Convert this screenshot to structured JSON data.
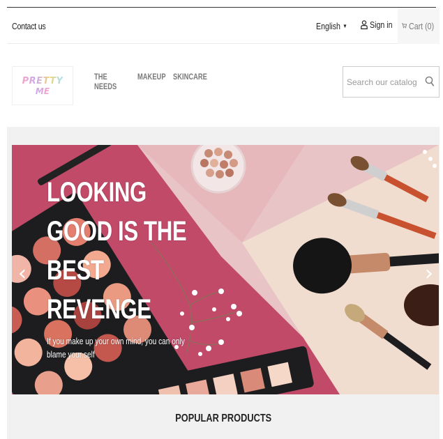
{
  "topbar": {
    "contact": "Contact us",
    "language": "English",
    "signin": "Sign in",
    "cart": "Cart (0)"
  },
  "header": {
    "logo_line1": "PRETTY",
    "logo_line2": "ME",
    "nav": [
      "THE NEEDS",
      "MAKEUP",
      "SKINCARE"
    ],
    "search_placeholder": "Search our catalog"
  },
  "slider": {
    "title_lines": [
      "LOOKING",
      "GOOD IS THE",
      "BEST",
      "REVENGE"
    ],
    "subtitle": "If you make up your own mind, you can only blame your self",
    "prev": "‹",
    "next": "›"
  },
  "section": {
    "popular": "POPULAR PRODUCTS"
  },
  "colors": {
    "hero_bg": "#c14a68",
    "hero_light": "#f1ddd0",
    "hero_pink": "#e8c4c6"
  }
}
